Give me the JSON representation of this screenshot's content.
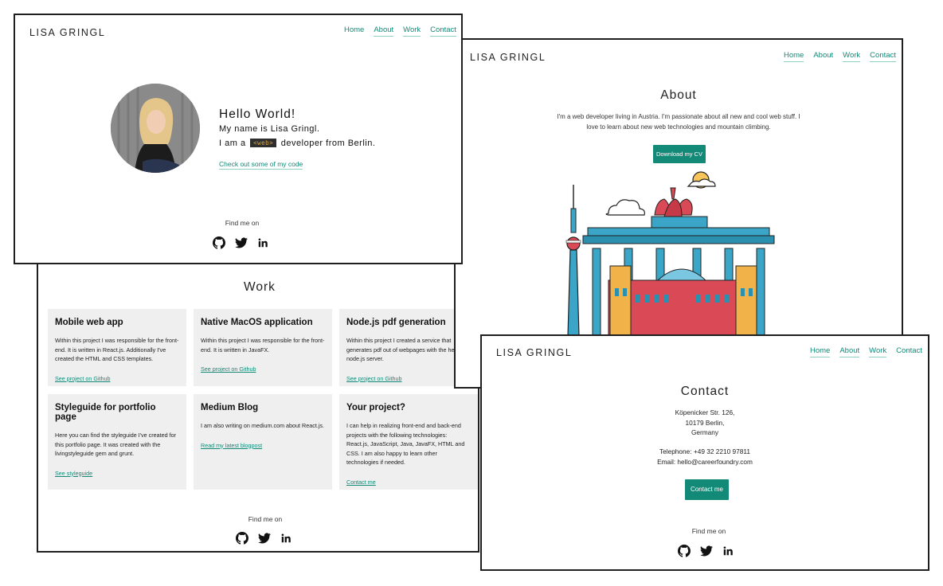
{
  "brand": {
    "name": "LISA GRINGL",
    "accent": "#138a78"
  },
  "nav": [
    "Home",
    "About",
    "Work",
    "Contact"
  ],
  "home": {
    "greeting": "Hello World!",
    "intro": "My name is Lisa Gringl.",
    "role_prefix": "I am a",
    "role_tag": "<web>",
    "role_suffix": "developer from Berlin.",
    "cta_link": "Check out some of my code",
    "find_me": "Find me on"
  },
  "about": {
    "title": "About",
    "text": "I'm a web developer living in Austria. I'm passionate about all new and cool web stuff. I love to learn about new web technologies and mountain climbing.",
    "button": "Download my CV"
  },
  "work": {
    "title": "Work",
    "find_me": "Find me on",
    "cards": [
      {
        "title": "Mobile web app",
        "text": "Within this project I was responsible for the front-end. It is written in React.js. Additionally I've created the HTML and CSS templates.",
        "link": "See project on Github"
      },
      {
        "title": "Native MacOS application",
        "text": "Within this project I was responsible for the front-end. It is written in JavaFX.",
        "link": "See project on Github"
      },
      {
        "title": "Node.js pdf generation",
        "text": "Within this project I created a service that generates pdf out of webpages with the help of a node.js server.",
        "link": "See project on Github"
      },
      {
        "title": "Styleguide for portfolio page",
        "text": "Here you can find the styleguide I've created for this portfolio page. It was created with the livingstyleguide gem and grunt.",
        "link": "See styleguide"
      },
      {
        "title": "Medium Blog",
        "text": "I am also writing on medium.com about React.js.",
        "link": "Read my latest blogpost"
      },
      {
        "title": "Your project?",
        "text": "I can help in realizing front-end and back-end projects with the following technologies: React.js, JavaScript, Java, JavaFX, HTML and CSS. I am also happy to learn other technologies if needed.",
        "link": "Contact me"
      }
    ]
  },
  "contact": {
    "title": "Contact",
    "address": [
      "Köpenicker Str. 126,",
      "10179 Berlin,",
      "Germany"
    ],
    "telephone": "Telephone: +49 32 2210 97811",
    "email": "Email: hello@careerfoundry.com",
    "button": "Contact me",
    "find_me": "Find me on"
  },
  "icons": [
    "github-icon",
    "twitter-icon",
    "linkedin-icon"
  ]
}
